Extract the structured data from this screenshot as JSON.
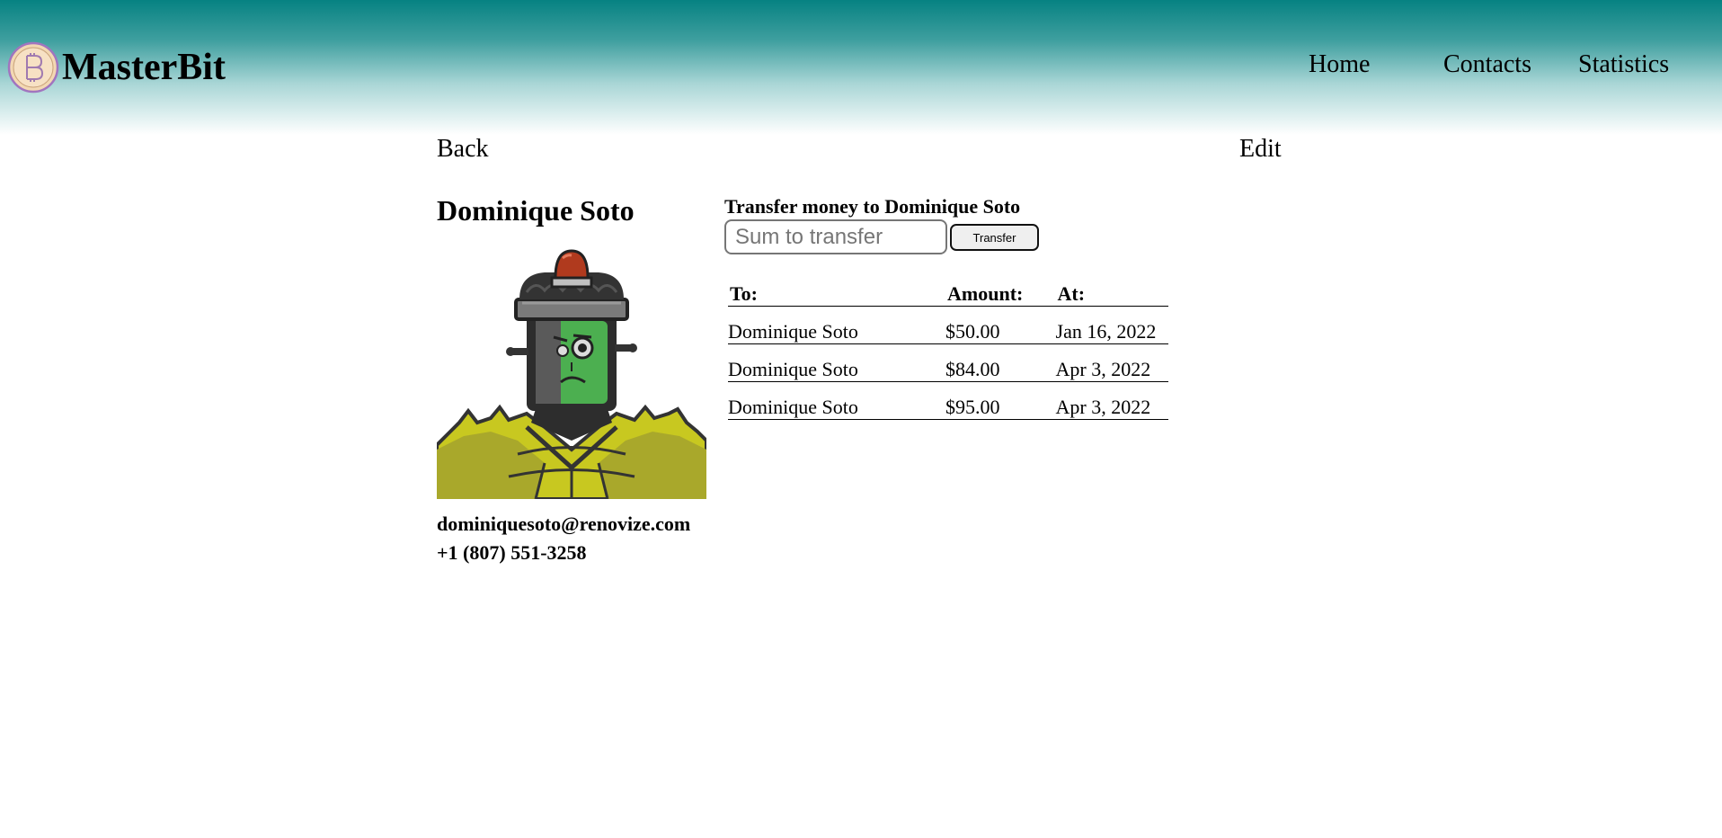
{
  "app": {
    "brand": "MasterBit",
    "logo_icon": "bitcoin-icon"
  },
  "nav": {
    "home": "Home",
    "contacts": "Contacts",
    "statistics": "Statistics"
  },
  "subnav": {
    "back": "Back",
    "edit": "Edit"
  },
  "contact": {
    "name": "Dominique Soto",
    "email": "dominiquesoto@renovize.com",
    "phone": "+1 (807) 551-3258",
    "avatar_icon": "robot-avatar-icon"
  },
  "transfer": {
    "title": "Transfer money to Dominique Soto",
    "placeholder": "Sum to transfer",
    "value": "",
    "button_label": "Transfer"
  },
  "transactions": {
    "headers": [
      "To:",
      "Amount:",
      "At:"
    ],
    "rows": [
      {
        "to": "Dominique Soto",
        "amount": "$50.00",
        "at": "Jan 16, 2022"
      },
      {
        "to": "Dominique Soto",
        "amount": "$84.00",
        "at": "Apr 3, 2022"
      },
      {
        "to": "Dominique Soto",
        "amount": "$95.00",
        "at": "Apr 3, 2022"
      }
    ]
  },
  "colors": {
    "header_top": "#068282",
    "header_bottom": "#ffffff",
    "logo_fill": "#f5d9b6",
    "logo_stroke": "#9a6ab8"
  }
}
